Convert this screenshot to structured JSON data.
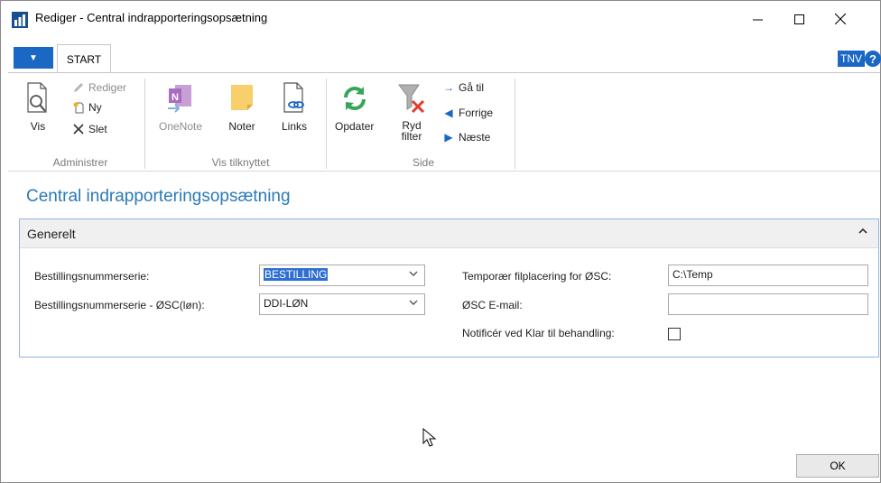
{
  "window": {
    "title": "Rediger - Central indrapporteringsopsætning",
    "controls": {
      "minimize": "—",
      "maximize": "☐",
      "close": "✕"
    }
  },
  "ribbon": {
    "file_tab_glyph": "▼",
    "tabs": [
      {
        "label": "START"
      }
    ],
    "user_badge": "TNV",
    "help_glyph": "?",
    "groups": {
      "administrer": {
        "label": "Administrer",
        "vis": "Vis",
        "rediger": "Rediger",
        "ny": "Ny",
        "slet": "Slet"
      },
      "vis_tilknyttet": {
        "label": "Vis tilknyttet",
        "onenote": "OneNote",
        "noter": "Noter",
        "links": "Links"
      },
      "side": {
        "label": "Side",
        "opdater": "Opdater",
        "ryd_filter_line1": "Ryd",
        "ryd_filter_line2": "filter",
        "gaa_til": "Gå til",
        "forrige": "Forrige",
        "naeste": "Næste"
      }
    }
  },
  "page": {
    "title": "Central indrapporteringsopsætning"
  },
  "generelt": {
    "title": "Generelt",
    "fields": {
      "bestillingsnummerserie": {
        "label": "Bestillingsnummerserie:",
        "value": "BESTILLING"
      },
      "bestillingsnummerserie_osc": {
        "label": "Bestillingsnummerserie - ØSC(løn):",
        "value": "DDI-LØN"
      },
      "temp_filplacering": {
        "label": "Temporær filplacering for ØSC:",
        "value": "C:\\Temp"
      },
      "osc_email": {
        "label": "ØSC E-mail:",
        "value": ""
      },
      "notificer": {
        "label": "Notificér ved Klar til behandling:",
        "checked": false
      }
    }
  },
  "footer": {
    "ok_label": "OK"
  },
  "colors": {
    "accent": "#1a67c4",
    "title_blue": "#2a7ab8",
    "fasttab_border": "#8fb6df",
    "selection": "#2f6fd1"
  }
}
